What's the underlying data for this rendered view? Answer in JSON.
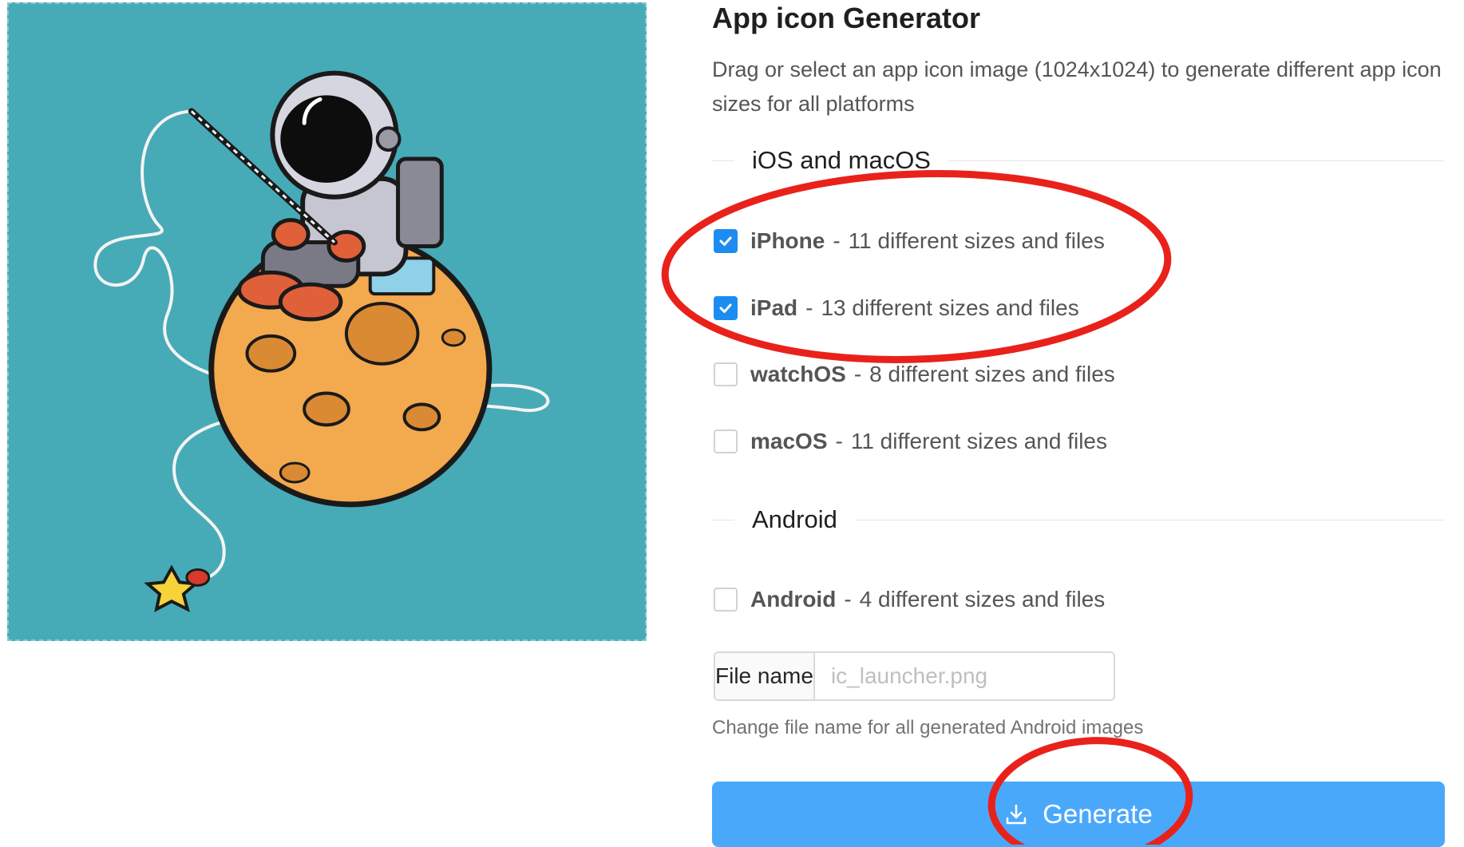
{
  "header": {
    "title": "App icon Generator",
    "description": "Drag or select an app icon image (1024x1024) to generate different app icon sizes for all platforms"
  },
  "sections": {
    "ios": {
      "label": "iOS and macOS"
    },
    "android": {
      "label": "Android"
    }
  },
  "options": [
    {
      "name": "iPhone",
      "separator": "-",
      "desc": "11 different sizes and files",
      "checked": true
    },
    {
      "name": "iPad",
      "separator": "-",
      "desc": "13 different sizes and files",
      "checked": true
    },
    {
      "name": "watchOS",
      "separator": "-",
      "desc": "8 different sizes and files",
      "checked": false
    },
    {
      "name": "macOS",
      "separator": "-",
      "desc": "11 different sizes and files",
      "checked": false
    },
    {
      "name": "Android",
      "separator": "-",
      "desc": "4 different sizes and files",
      "checked": false
    }
  ],
  "file_name": {
    "label": "File name",
    "placeholder": "ic_launcher.png",
    "value": "",
    "hint": "Change file name for all generated Android images"
  },
  "generate_button": {
    "label": "Generate",
    "icon": "download-icon"
  },
  "preview": {
    "icon": "astronaut-on-moon-image"
  },
  "colors": {
    "primary": "#4aa8fb",
    "checkbox_checked": "#1d8cf0",
    "preview_background": "#47aab7",
    "annotation": "#e8221b"
  }
}
